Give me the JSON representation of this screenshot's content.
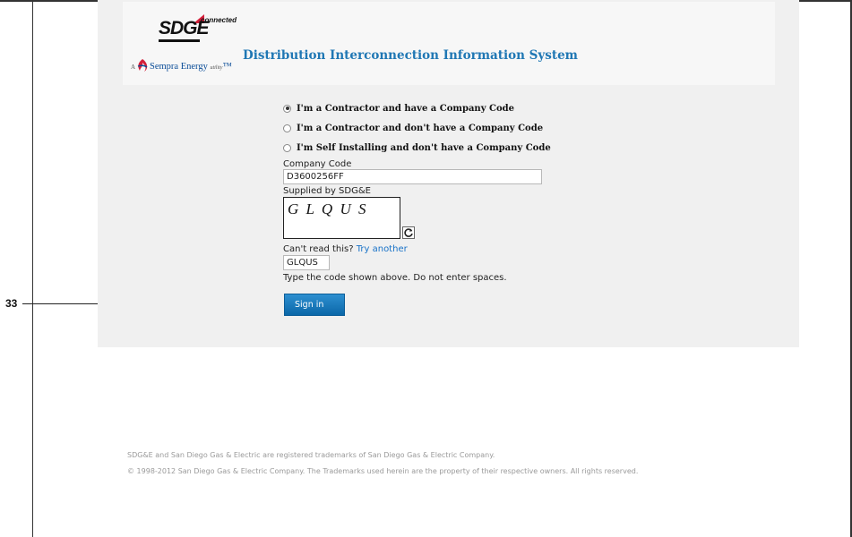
{
  "callout": {
    "number": "33"
  },
  "brand": {
    "logo_text": "SDGE",
    "logo_tagline": "connected",
    "parent_prefix": "A",
    "parent_name": "Sempra Energy",
    "parent_suffix": "utility",
    "system_title": "Distribution Interconnection Information System",
    "accent_color": "#1f77b4",
    "logo_red": "#d31f3a"
  },
  "form": {
    "options": [
      {
        "label": "I'm a Contractor and have a Company Code",
        "checked": true
      },
      {
        "label": "I'm a Contractor and don't have a Company Code",
        "checked": false
      },
      {
        "label": "I'm Self Installing and don't have a Company Code",
        "checked": false
      }
    ],
    "company_code_label": "Company Code",
    "company_code_value": "D3600256FF",
    "supplied_label": "Supplied by SDG&E",
    "captcha_image_text": "G L Q U S",
    "cant_read_text": "Can't read this?",
    "try_another_link": "Try another",
    "captcha_input_value": "GLQUS",
    "captcha_hint": "Type the code shown above. Do not enter spaces.",
    "signin_label": "Sign in"
  },
  "footer": {
    "line1": "SDG&E and San Diego Gas & Electric are registered trademarks of San Diego Gas & Electric Company.",
    "line2": "© 1998-2012 San Diego Gas & Electric Company. The Trademarks used herein are the property of their respective owners. All rights reserved."
  }
}
